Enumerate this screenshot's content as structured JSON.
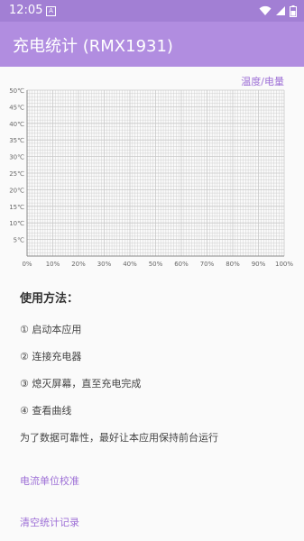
{
  "status_bar": {
    "time": "12:05",
    "notification_icon": "A",
    "icons": [
      "wifi-icon",
      "signal-icon",
      "battery-icon"
    ],
    "color": "#a27fd4"
  },
  "app_bar": {
    "title": "充电统计 (RMX1931)",
    "color": "#b18de0"
  },
  "chart_data": {
    "type": "line",
    "legend": "温度/电量",
    "y_tick_labels": [
      "50℃",
      "45℃",
      "40℃",
      "35℃",
      "30℃",
      "25℃",
      "20℃",
      "15℃",
      "10℃",
      "5℃"
    ],
    "x_tick_labels": [
      "0%",
      "10%",
      "20%",
      "30%",
      "40%",
      "50%",
      "60%",
      "70%",
      "80%",
      "90%",
      "100%"
    ],
    "xlim": [
      0,
      100
    ],
    "ylim": [
      0,
      50
    ],
    "grid": true,
    "series": [],
    "grid_color": "#c8c8c8"
  },
  "instructions": {
    "title": "使用方法：",
    "steps": [
      "① 启动本应用",
      "② 连接充电器",
      "③ 熄灭屏幕，直至充电完成",
      "④ 查看曲线"
    ],
    "note": "为了数据可靠性，最好让本应用保持前台运行"
  },
  "links": {
    "calibrate": "电流单位校准",
    "clear": "清空统计记录",
    "color": "#9d6fd6"
  }
}
